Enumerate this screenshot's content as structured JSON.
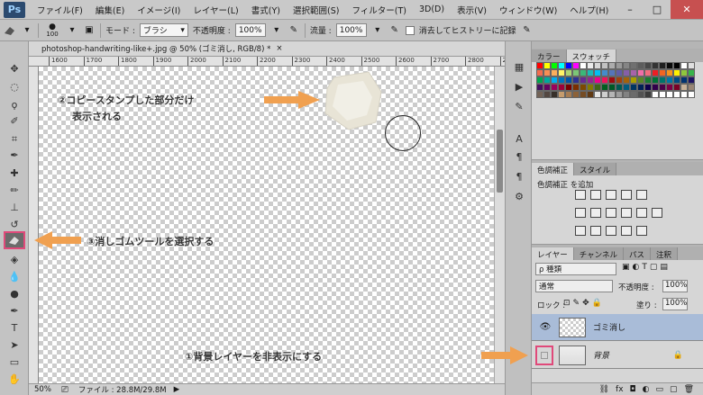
{
  "app": {
    "logo": "Ps"
  },
  "menu": [
    "ファイル(F)",
    "編集(E)",
    "イメージ(I)",
    "レイヤー(L)",
    "書式(Y)",
    "選択範囲(S)",
    "フィルター(T)",
    "3D(D)",
    "表示(V)",
    "ウィンドウ(W)",
    "ヘルプ(H)"
  ],
  "window_buttons": {
    "minimize": "–",
    "maximize": "□",
    "close": "✕"
  },
  "options": {
    "brush_size": "100",
    "mode_label": "モード :",
    "mode_value": "ブラシ",
    "opacity_label": "不透明度 :",
    "opacity_value": "100%",
    "flow_label": "流量 :",
    "flow_value": "100%",
    "history_label": "消去してヒストリーに記録"
  },
  "document": {
    "tab_title": "photoshop-handwriting-like+.jpg @ 50% (ゴミ消し, RGB/8) *",
    "close": "×",
    "ruler_ticks": [
      "1600",
      "1700",
      "1800",
      "1900",
      "2000",
      "2100",
      "2200",
      "2300",
      "2400",
      "2500",
      "2600",
      "2700",
      "2800",
      "2900"
    ],
    "zoom": "50%",
    "file_info": "ファイル : 28.8M/29.8M"
  },
  "annotations": {
    "stamp_note_line1": "②コピースタンプした部分だけ",
    "stamp_note_line2": "表示される",
    "eraser_note": "③消しゴムツールを選択する",
    "bg_note": "①背景レイヤーを非表示にする"
  },
  "colors": {
    "accent_arrow": "#f0a050",
    "highlight_border": "#e0497a",
    "selected_layer": "#a9bcd8"
  },
  "panels": {
    "color_tabs": [
      "カラー",
      "スウォッチ"
    ],
    "adjust_tabs": [
      "色調補正",
      "スタイル"
    ],
    "adjust_title": "色調補正 を追加",
    "layer_tabs": [
      "レイヤー",
      "チャンネル",
      "パス",
      "注釈"
    ],
    "kind_filter": "ρ 種類",
    "blend_mode": "通常",
    "opacity_label": "不透明度 :",
    "opacity_value": "100%",
    "lock_label": "ロック :",
    "fill_label": "塗り :",
    "fill_value": "100%",
    "layers": [
      {
        "name": "ゴミ消し",
        "visible": true,
        "selected": true
      },
      {
        "name": "背景",
        "visible": false,
        "selected": false
      }
    ],
    "footer_icons": [
      "link-icon",
      "fx-icon",
      "mask-icon",
      "adjustment-icon",
      "folder-icon",
      "new-layer-icon",
      "trash-icon"
    ]
  }
}
